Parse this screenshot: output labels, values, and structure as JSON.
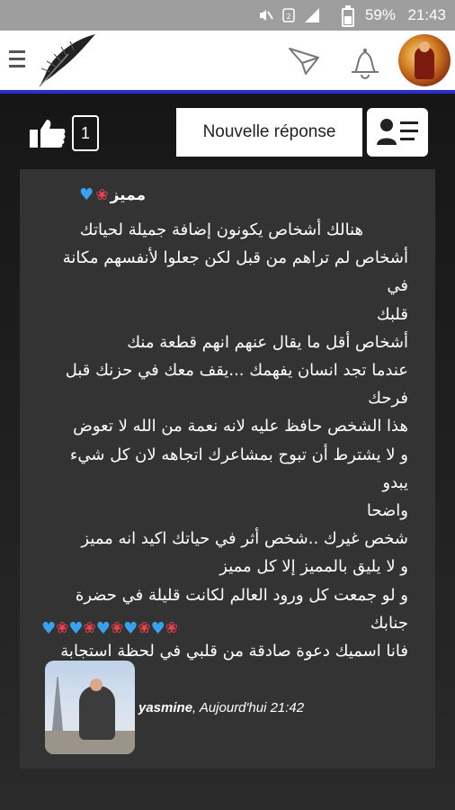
{
  "status_bar": {
    "battery": "59%",
    "time": "21:43",
    "icons": [
      "mute-icon",
      "sim-icon",
      "signal-icon"
    ]
  },
  "app_bar": {
    "icons": [
      "menu-icon",
      "feather-logo-icon",
      "send-icon",
      "bell-icon",
      "avatar"
    ]
  },
  "toolbar": {
    "like_count": "1",
    "reply_label": "Nouvelle réponse",
    "icons": [
      "thumbs-up-icon",
      "profile-card-icon"
    ]
  },
  "post": {
    "title": "مميز",
    "body_lines": [
      "هنالك أشخاص يكونون إضافة جميلة لحياتك",
      "أشخاص لم تراهم من قبل لكن جعلوا لأنفسهم مكانة في",
      "قلبك",
      "أشخاص أقل ما يقال عنهم انهم قطعة منك",
      "عندما تجد انسان يفهمك ...يقف معك في حزنك قبل",
      "فرحك",
      "هذا الشخص حافظ عليه لانه نعمة من الله لا تعوض",
      "و لا يشترط أن تبوح بمشاعرك اتجاهه لان كل شيء يبدو",
      "واضحا",
      "شخص غيرك ..شخص أثر في حياتك اكيد انه مميز",
      "و لا يليق بالمميز إلا كل مميز",
      "و لو جمعت كل ورود العالم لكانت قليلة في حضرة",
      "جنابك",
      "فانا اسميك دعوة صادقة من قلبي في لحظة استجابة"
    ],
    "emoji_sequence": [
      "rose",
      "heart",
      "rose",
      "heart",
      "rose",
      "heart",
      "rose",
      "heart",
      "rose",
      "heart"
    ],
    "author": "yasmine",
    "timestamp": ", Aujourd'hui 21:42"
  },
  "colors": {
    "accent": "#2b2fd0",
    "heart": "#3aa0f0",
    "rose": "#e8414f"
  }
}
